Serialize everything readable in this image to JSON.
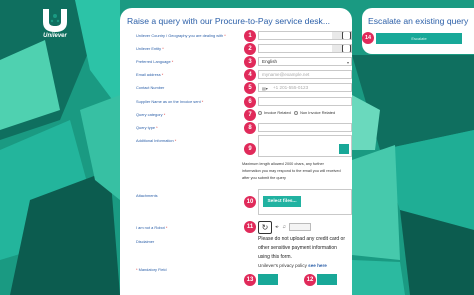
{
  "brand": {
    "logo_text": "Unilever",
    "bg_color": "#1a9a82",
    "accent_badge": "#e02a5a",
    "button_color": "#18a898"
  },
  "form": {
    "title": "Raise a query with our Procure-to-Pay service desk...",
    "fields": [
      {
        "n": "1",
        "label": "Unilever Country / Geography you are dealing with",
        "required": true,
        "value": "",
        "kind": "select"
      },
      {
        "n": "2",
        "label": "Unilever Entity",
        "required": true,
        "value": "",
        "kind": "select"
      },
      {
        "n": "3",
        "label": "Preferred Language",
        "required": true,
        "value": "English",
        "kind": "select"
      },
      {
        "n": "4",
        "label": "Email address",
        "required": true,
        "placeholder": "myname@example.net",
        "kind": "input"
      },
      {
        "n": "5",
        "label": "Contact Number",
        "required": false,
        "placeholder": "+1 201-555-0123",
        "kind": "phone",
        "flag": "US-flag-icon"
      },
      {
        "n": "6",
        "label": "Supplier Name as on the Invoice sent",
        "required": true,
        "value": "",
        "kind": "input"
      },
      {
        "n": "7",
        "label": "Query category",
        "required": true,
        "options": [
          "Invoice Related",
          "Non Invoice Related"
        ],
        "kind": "radio"
      },
      {
        "n": "8",
        "label": "Query type",
        "required": true,
        "value": "",
        "kind": "select"
      },
      {
        "n": "9",
        "label": "Additional Information",
        "required": true,
        "kind": "textarea"
      }
    ],
    "textarea_note": "Maximum length allowed 2000 chars, any further information you may respond to the email you will received after you submit the query",
    "attachments": {
      "label": "Attachments",
      "n": "10",
      "button": "Select files..."
    },
    "robot": {
      "label": "I am not a Robot",
      "n": "11",
      "refresh_icon": "refresh-icon",
      "audio_icon": "speaker-icon",
      "prev_icon": "arrow-left-icon"
    },
    "disclaimer": {
      "label": "Disclaimer",
      "text": "Please do not upload any credit card or other sensitive payment information using this form.",
      "privacy_prefix": "Unilever's privacy policy",
      "privacy_link": "see here"
    },
    "mandatory_note": "Mandatory Field",
    "bottom_buttons": [
      {
        "n": "13"
      },
      {
        "n": "12"
      }
    ]
  },
  "escalate": {
    "title": "Escalate an existing query",
    "n": "14",
    "button": "Escalate"
  }
}
